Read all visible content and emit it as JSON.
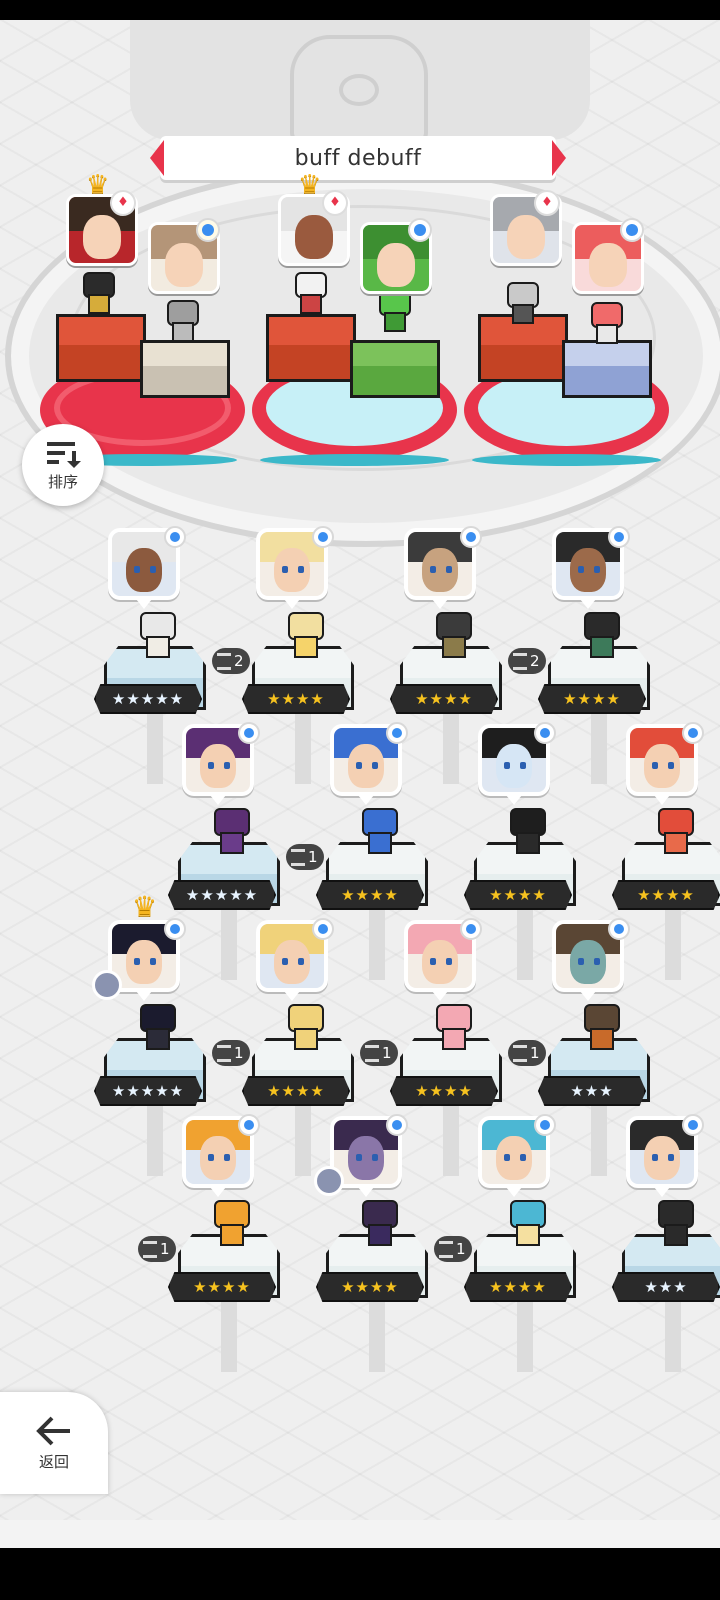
{
  "header": {
    "title": "buff debuff"
  },
  "sort_button": {
    "label": "排序",
    "icon": "sort-icon"
  },
  "back_button": {
    "label": "返回",
    "icon": "arrow-left-icon"
  },
  "colors": {
    "accent_red": "#e8344b",
    "badge_blue": "#3a8ef0",
    "star_gold": "#f6c21f"
  },
  "team": [
    {
      "slot": "left",
      "pair": [
        {
          "badge": "red-diamond",
          "crown": true
        },
        {
          "badge": "sparkle"
        }
      ]
    },
    {
      "slot": "middle",
      "pair": [
        {
          "badge": "red-diamond",
          "crown": true
        },
        {
          "badge": "leaf"
        }
      ]
    },
    {
      "slot": "right",
      "pair": [
        {
          "badge": "red-diamond"
        },
        {
          "badge": "blue-dot"
        }
      ]
    }
  ],
  "roster": [
    {
      "stars": "★★★★★",
      "star_color": "white",
      "count": ""
    },
    {
      "stars": "★★★★",
      "star_color": "gold",
      "count": "2"
    },
    {
      "stars": "★★★★",
      "star_color": "gold",
      "count": ""
    },
    {
      "stars": "★★★★",
      "star_color": "gold",
      "count": "2"
    },
    {
      "stars": "★★★★★",
      "star_color": "white",
      "count": ""
    },
    {
      "stars": "★★★★",
      "star_color": "gold",
      "count": "1"
    },
    {
      "stars": "★★★★",
      "star_color": "gold",
      "count": ""
    },
    {
      "stars": "★★★★",
      "star_color": "gold",
      "count": ""
    },
    {
      "stars": "★★★★★",
      "star_color": "white",
      "count": "",
      "crown": true
    },
    {
      "stars": "★★★★",
      "star_color": "gold",
      "count": "1"
    },
    {
      "stars": "★★★★",
      "star_color": "gold",
      "count": "1"
    },
    {
      "stars": "★★★",
      "star_color": "white",
      "count": "1"
    },
    {
      "stars": "★★★★",
      "star_color": "gold",
      "count": "1"
    },
    {
      "stars": "★★★★",
      "star_color": "gold",
      "count": ""
    },
    {
      "stars": "★★★★",
      "star_color": "gold",
      "count": "1"
    },
    {
      "stars": "★★★",
      "star_color": "white",
      "count": ""
    }
  ]
}
